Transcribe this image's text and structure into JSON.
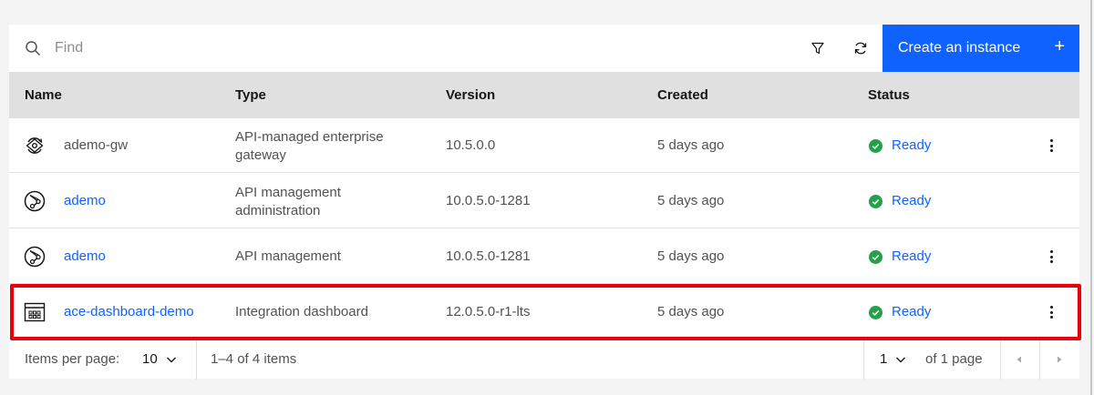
{
  "toolbar": {
    "search_placeholder": "Find",
    "search_icon": "search-icon",
    "filter_icon": "filter-icon",
    "refresh_icon": "refresh-icon",
    "create_label": "Create an instance",
    "create_plus": "+",
    "accent_color": "#0f62fe"
  },
  "table": {
    "headers": [
      "Name",
      "Type",
      "Version",
      "Created",
      "Status"
    ],
    "rows": [
      {
        "icon": "gateway-icon",
        "name": "ademo-gw",
        "name_link": false,
        "type_line1": "API-managed enterprise",
        "type_line2": "gateway",
        "version": "10.5.0.0",
        "created": "5 days ago",
        "status": "Ready",
        "overflow": true
      },
      {
        "icon": "api-management-icon",
        "name": "ademo",
        "name_link": true,
        "type_line1": "API management",
        "type_line2": "administration",
        "version": "10.0.5.0-1281",
        "created": "5 days ago",
        "status": "Ready",
        "overflow": false
      },
      {
        "icon": "api-management-icon",
        "name": "ademo",
        "name_link": true,
        "type_line1": "API management",
        "type_line2": "",
        "version": "10.0.5.0-1281",
        "created": "5 days ago",
        "status": "Ready",
        "overflow": true
      },
      {
        "icon": "dashboard-icon",
        "name": "ace-dashboard-demo",
        "name_link": true,
        "type_line1": "Integration dashboard",
        "type_line2": "",
        "version": "12.0.5.0-r1-lts",
        "created": "5 days ago",
        "status": "Ready",
        "overflow": true
      }
    ],
    "status_color": "#24a148"
  },
  "pagination": {
    "items_per_page_label": "Items per page:",
    "items_per_page_value": "10",
    "range_text": "1–4 of 4 items",
    "page_value": "1",
    "of_pages": "of 1 page"
  }
}
